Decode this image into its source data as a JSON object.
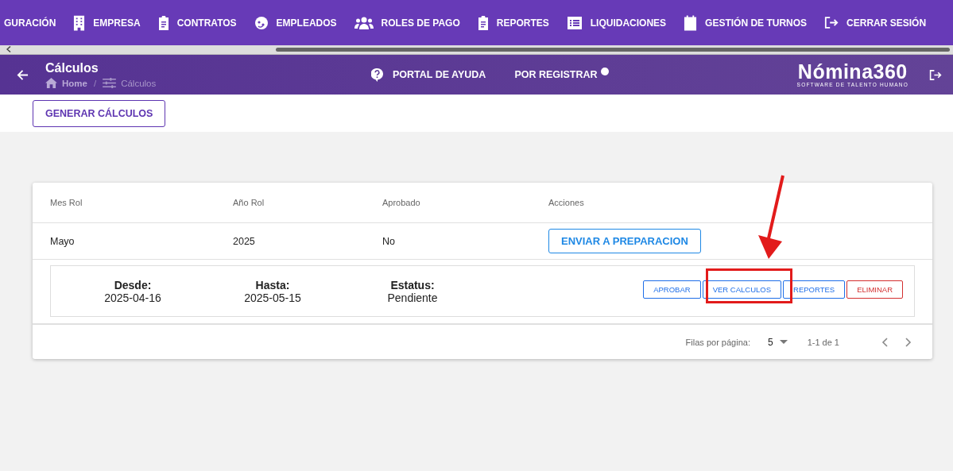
{
  "nav": {
    "items": [
      {
        "label": "GURACIÓN"
      },
      {
        "label": "EMPRESA"
      },
      {
        "label": "CONTRATOS"
      },
      {
        "label": "EMPLEADOS"
      },
      {
        "label": "ROLES DE PAGO"
      },
      {
        "label": "REPORTES"
      },
      {
        "label": "LIQUIDACIONES"
      },
      {
        "label": "GESTIÓN DE TURNOS"
      },
      {
        "label": "CERRAR SESIÓN"
      }
    ]
  },
  "header": {
    "title": "Cálculos",
    "breadcrumb": [
      "Home",
      "Cálculos"
    ],
    "breadcrumb_separator": "/",
    "help": "PORTAL DE AYUDA",
    "register": "POR REGISTRAR",
    "logo": {
      "name": "Nómina360",
      "tagline": "SOFTWARE DE TALENTO HUMANO"
    }
  },
  "toolbar": {
    "button": "GENERAR CÁLCULOS"
  },
  "table": {
    "columns": [
      "Mes Rol",
      "Año Rol",
      "Aprobado",
      "Acciones"
    ],
    "rows": [
      {
        "cells": [
          "Mayo",
          "2025",
          "No"
        ],
        "action": "ENVIAR A PREPARACION",
        "expanded": true,
        "details": [
          {
            "label": "Desde:",
            "value": "2025-04-16"
          },
          {
            "label": "Hasta:",
            "value": "2025-05-15"
          },
          {
            "label": "Estatus:",
            "value": "Pendiente"
          }
        ],
        "buttons": [
          {
            "label": "APROBAR",
            "color": "#1e6ee8"
          },
          {
            "label": "VER CALCULOS",
            "color": "#1e6ee8"
          },
          {
            "label": "REPORTES",
            "color": "#1e6ee8"
          },
          {
            "label": "ELIMINAR",
            "color": "#d32f2f"
          }
        ]
      }
    ],
    "footer": {
      "rows_label": "Filas por página:",
      "rows_value": "5",
      "range": "1-1 de 1"
    }
  }
}
